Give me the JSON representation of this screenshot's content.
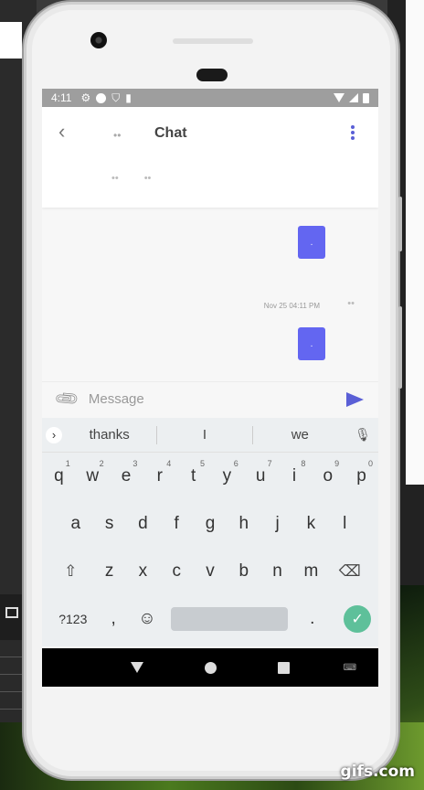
{
  "statusbar": {
    "time": "4:11"
  },
  "header": {
    "title": "Chat",
    "avatar_glyph": "••",
    "participants": [
      "••",
      "••"
    ]
  },
  "messages": {
    "bubble1_text": ".",
    "timestamp": "Nov 25 04:11 PM",
    "avatar_glyph": "••",
    "bubble2_text": "."
  },
  "composer": {
    "placeholder": "Message"
  },
  "keyboard": {
    "suggestions": [
      "thanks",
      "I",
      "we"
    ],
    "row1": [
      {
        "k": "q",
        "n": "1"
      },
      {
        "k": "w",
        "n": "2"
      },
      {
        "k": "e",
        "n": "3"
      },
      {
        "k": "r",
        "n": "4"
      },
      {
        "k": "t",
        "n": "5"
      },
      {
        "k": "y",
        "n": "6"
      },
      {
        "k": "u",
        "n": "7"
      },
      {
        "k": "i",
        "n": "8"
      },
      {
        "k": "o",
        "n": "9"
      },
      {
        "k": "p",
        "n": "0"
      }
    ],
    "row2": [
      "a",
      "s",
      "d",
      "f",
      "g",
      "h",
      "j",
      "k",
      "l"
    ],
    "row3": [
      "z",
      "x",
      "c",
      "v",
      "b",
      "n",
      "m"
    ],
    "symbols_label": "?123",
    "comma": ",",
    "period": "."
  },
  "watermark": "gifs.com",
  "colors": {
    "accent": "#6366f1",
    "enter": "#5ec09a"
  }
}
